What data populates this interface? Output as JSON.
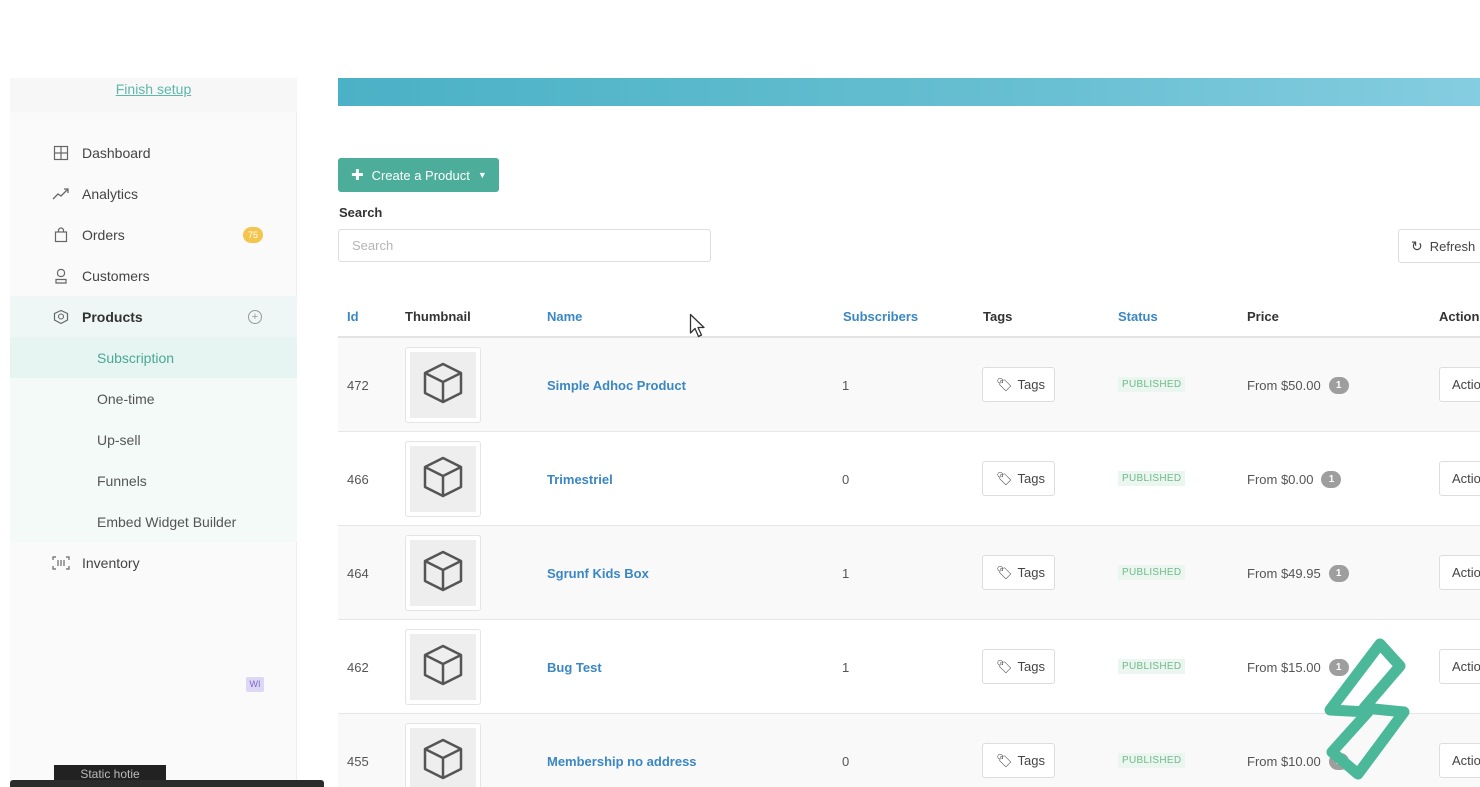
{
  "sidebar": {
    "finish_setup": "Finish setup",
    "items": [
      {
        "label": "Dashboard",
        "icon": "dashboard-icon"
      },
      {
        "label": "Analytics",
        "icon": "analytics-icon"
      },
      {
        "label": "Orders",
        "icon": "bag-icon",
        "badge": "75"
      },
      {
        "label": "Customers",
        "icon": "customer-icon"
      },
      {
        "label": "Products",
        "icon": "products-icon"
      }
    ],
    "products_sub": [
      "Subscription",
      "One-time",
      "Up-sell",
      "Funnels",
      "Embed Widget Builder"
    ],
    "inventory": "Inventory",
    "wi_tag": "WI",
    "bottom_pill": "Static hotie"
  },
  "toolbar": {
    "create_label": "Create a Product",
    "search_label": "Search",
    "search_placeholder": "Search",
    "refresh_label": "Refresh"
  },
  "table": {
    "headers": {
      "id": "Id",
      "thumbnail": "Thumbnail",
      "name": "Name",
      "subscribers": "Subscribers",
      "tags": "Tags",
      "status": "Status",
      "price": "Price",
      "actions": "Action"
    },
    "rows": [
      {
        "id": "472",
        "name": "Simple Adhoc Product",
        "subscribers": "1",
        "tags": "Tags",
        "status": "PUBLISHED",
        "price": "From $50.00",
        "price_count": "1",
        "action": "Actio"
      },
      {
        "id": "466",
        "name": "Trimestriel",
        "subscribers": "0",
        "tags": "Tags",
        "status": "PUBLISHED",
        "price": "From $0.00",
        "price_count": "1",
        "action": "Actio"
      },
      {
        "id": "464",
        "name": "Sgrunf Kids Box",
        "subscribers": "1",
        "tags": "Tags",
        "status": "PUBLISHED",
        "price": "From $49.95",
        "price_count": "1",
        "action": "Actio"
      },
      {
        "id": "462",
        "name": "Bug Test",
        "subscribers": "1",
        "tags": "Tags",
        "status": "PUBLISHED",
        "price": "From $15.00",
        "price_count": "1",
        "action": "Actio"
      },
      {
        "id": "455",
        "name": "Membership no address",
        "subscribers": "0",
        "tags": "Tags",
        "status": "PUBLISHED",
        "price": "From $10.00",
        "price_count": "1",
        "action": "Actio"
      }
    ]
  },
  "colors": {
    "accent": "#4cae9a",
    "link": "#3a87c4",
    "banner": "#5bb8cc",
    "status_text": "#72b98a",
    "badge": "#f4c54e"
  }
}
